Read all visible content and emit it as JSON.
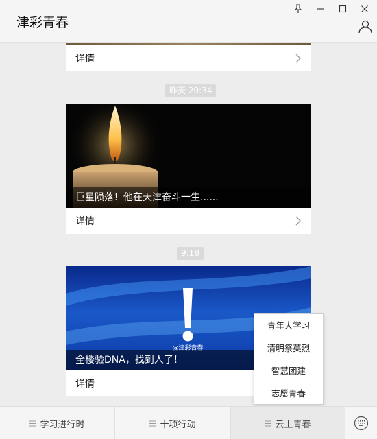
{
  "app": {
    "title": "津彩青春"
  },
  "window_controls": [
    "pin-icon",
    "minimize-icon",
    "maximize-icon",
    "close-icon"
  ],
  "feed": {
    "top_card": {
      "detail_label": "详情"
    },
    "messages": [
      {
        "time": "昨天 20:34",
        "caption": "巨星陨落！他在天津奋斗一生......",
        "detail_label": "详情"
      },
      {
        "time": "9:18",
        "caption": "全楼验DNA，找到人了！",
        "watermark": "@津彩青春",
        "detail_label": "详情"
      }
    ]
  },
  "popup_menu": {
    "items": [
      "青年大学习",
      "清明祭英烈",
      "智慧团建",
      "志愿青春"
    ]
  },
  "bottom_tabs": [
    {
      "label": "学习进行时"
    },
    {
      "label": "十项行动"
    },
    {
      "label": "云上青春",
      "active": true
    }
  ],
  "colors": {
    "background": "#ededed",
    "card": "#ffffff",
    "caption_overlay": "#000000"
  }
}
